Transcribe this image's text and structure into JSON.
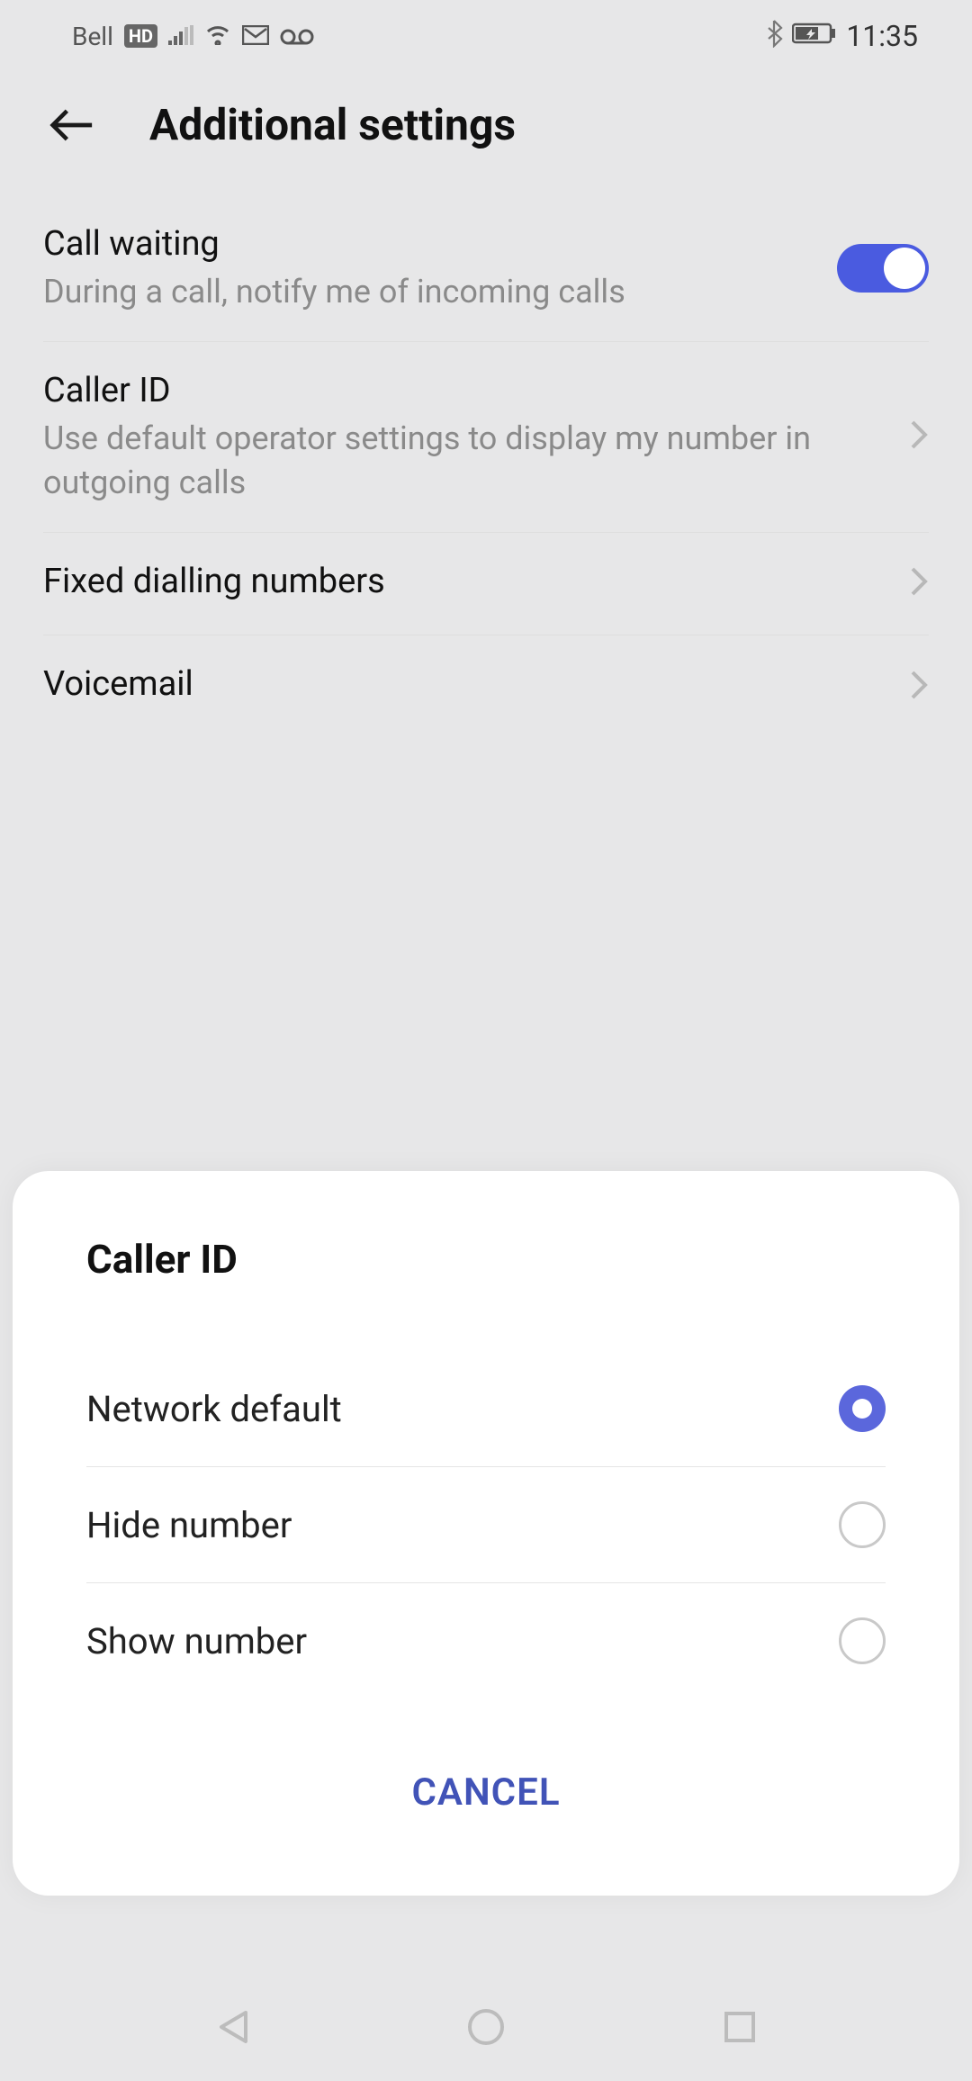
{
  "status": {
    "carrier": "Bell",
    "hd": "HD",
    "time": "11:35"
  },
  "header": {
    "title": "Additional settings"
  },
  "settings": {
    "call_waiting": {
      "title": "Call waiting",
      "desc": "During a call, notify me of incoming calls",
      "enabled": true
    },
    "caller_id": {
      "title": "Caller ID",
      "desc": "Use default operator settings to display my number in outgoing calls"
    },
    "fixed_dial": {
      "title": "Fixed dialling numbers"
    },
    "voicemail": {
      "title": "Voicemail"
    }
  },
  "dialog": {
    "title": "Caller ID",
    "options": [
      {
        "label": "Network default",
        "selected": true
      },
      {
        "label": "Hide number",
        "selected": false
      },
      {
        "label": "Show number",
        "selected": false
      }
    ],
    "cancel": "CANCEL"
  }
}
